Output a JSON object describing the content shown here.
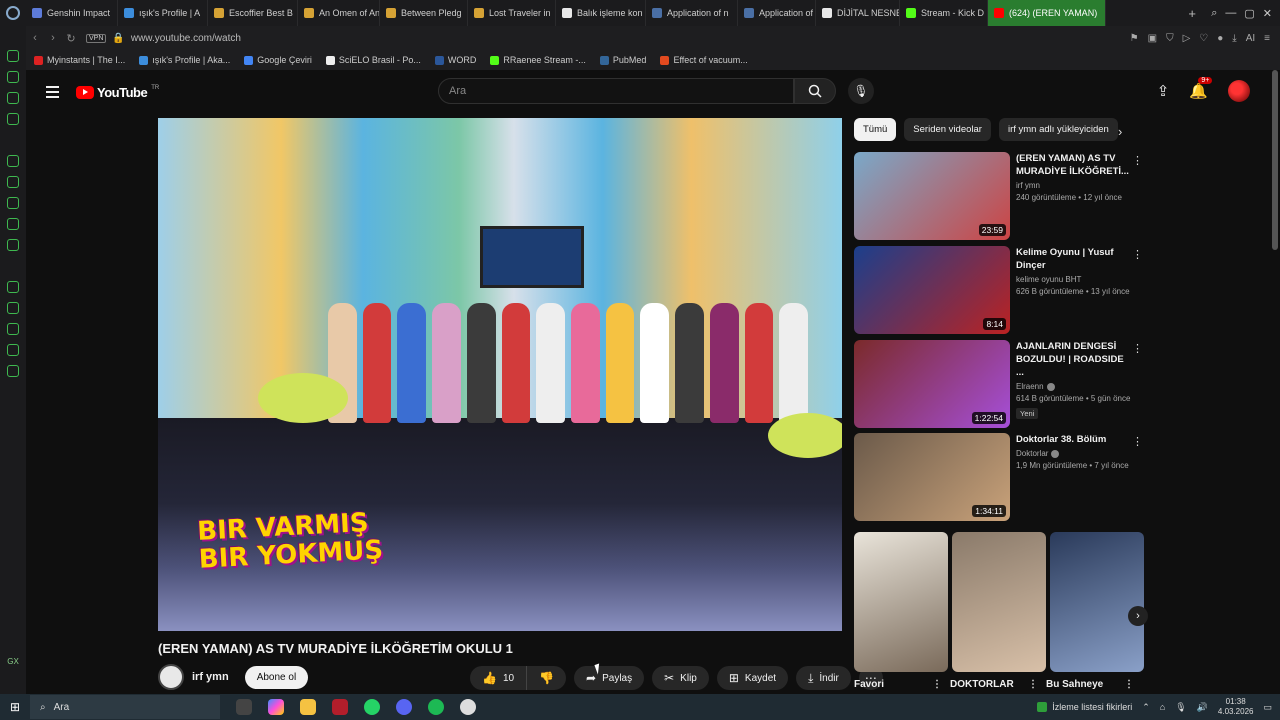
{
  "browser": {
    "tabs": [
      {
        "label": "Genshin Impact",
        "color": "#5d7bd9"
      },
      {
        "label": "ışık's Profile | A",
        "color": "#3c8ddc"
      },
      {
        "label": "Escoffier Best B",
        "color": "#d5a235"
      },
      {
        "label": "An Omen of An",
        "color": "#d5a235"
      },
      {
        "label": "Between Pledg",
        "color": "#d5a235"
      },
      {
        "label": "Lost Traveler in",
        "color": "#d5a235"
      },
      {
        "label": "Balık işleme kon",
        "color": "#e8e8e8"
      },
      {
        "label": "Application of n",
        "color": "#4a6fa5"
      },
      {
        "label": "Application of n",
        "color": "#4a6fa5"
      },
      {
        "label": "DİJİTAL NESNE",
        "color": "#e8e8e8"
      },
      {
        "label": "Stream - Kick D",
        "color": "#53fc18"
      },
      {
        "label": "(624) (EREN YAMAN)",
        "color": "#ff0000",
        "active": true
      }
    ],
    "url": "www.youtube.com/watch",
    "vpn_label": "VPN",
    "bookmarks": [
      {
        "label": "Myinstants | The I...",
        "color": "#d22"
      },
      {
        "label": "ışık's Profile | Aka...",
        "color": "#3c8ddc"
      },
      {
        "label": "Google Çeviri",
        "color": "#4285f4"
      },
      {
        "label": "SciELO Brasil - Po...",
        "color": "#eeeeee"
      },
      {
        "label": "WORD",
        "color": "#2b579a"
      },
      {
        "label": "RRaenee Stream -...",
        "color": "#53fc18"
      },
      {
        "label": "PubMed",
        "color": "#336699"
      },
      {
        "label": "Effect of vacuum...",
        "color": "#e24a1f"
      }
    ]
  },
  "yt": {
    "logo_text": "YouTube",
    "logo_sup": "TR",
    "search_placeholder": "Ara",
    "notif_count": "9+"
  },
  "video": {
    "title": "(EREN YAMAN) AS TV MURADİYE İLKÖĞRETİM OKULU 1",
    "overlay_logo_line1": "BIR VARMIŞ",
    "overlay_logo_line2": "BIR YOKMUŞ",
    "channel": "irf ymn",
    "subscribe": "Abone ol",
    "likes": "10",
    "share": "Paylaş",
    "clip": "Klip",
    "save": "Kaydet",
    "download": "İndir"
  },
  "chips": [
    "Tümü",
    "Seriden videolar",
    "irf ymn adlı yükleyiciden"
  ],
  "recommendations": [
    {
      "title": "(EREN YAMAN) AS TV MURADİYE İLKÖĞRETİ...",
      "channel": "irf ymn",
      "meta": "240 görüntüleme • 12 yıl önce",
      "duration": "23:59",
      "verified": false,
      "badge": "",
      "colors": [
        "#7aa9c9",
        "#c44"
      ]
    },
    {
      "title": "Kelime Oyunu | Yusuf Dinçer",
      "channel": "kelime oyunu BHT",
      "meta": "626 B görüntüleme • 13 yıl önce",
      "duration": "8:14",
      "verified": false,
      "badge": "",
      "colors": [
        "#1b3f8c",
        "#b22"
      ]
    },
    {
      "title": "AJANLARIN DENGESİ BOZULDU! | ROADSIDE ...",
      "channel": "Elraenn",
      "meta": "614 B görüntüleme • 5 gün önce",
      "duration": "1:22:54",
      "verified": true,
      "badge": "Yeni",
      "colors": [
        "#7b2a2a",
        "#a64fd9"
      ]
    },
    {
      "title": "Doktorlar 38. Bölüm",
      "channel": "Doktorlar",
      "meta": "1,9 Mn görüntüleme • 7 yıl önce",
      "duration": "1:34:11",
      "verified": true,
      "badge": "",
      "colors": [
        "#6b5a4a",
        "#c9a27a"
      ]
    }
  ],
  "shorts": [
    {
      "label": "Favori",
      "colors": [
        "#e9e4da",
        "#7a6a5a"
      ]
    },
    {
      "label": "DOKTORLAR",
      "colors": [
        "#8a7a6a",
        "#d8c0a8"
      ]
    },
    {
      "label": "Bu Sahneye",
      "colors": [
        "#2a3a5a",
        "#8aa0c8"
      ]
    }
  ],
  "taskbar": {
    "search": "Ara",
    "watchlist": "İzleme listesi fikirleri",
    "time": "01:38",
    "date": "4.03.2026"
  }
}
